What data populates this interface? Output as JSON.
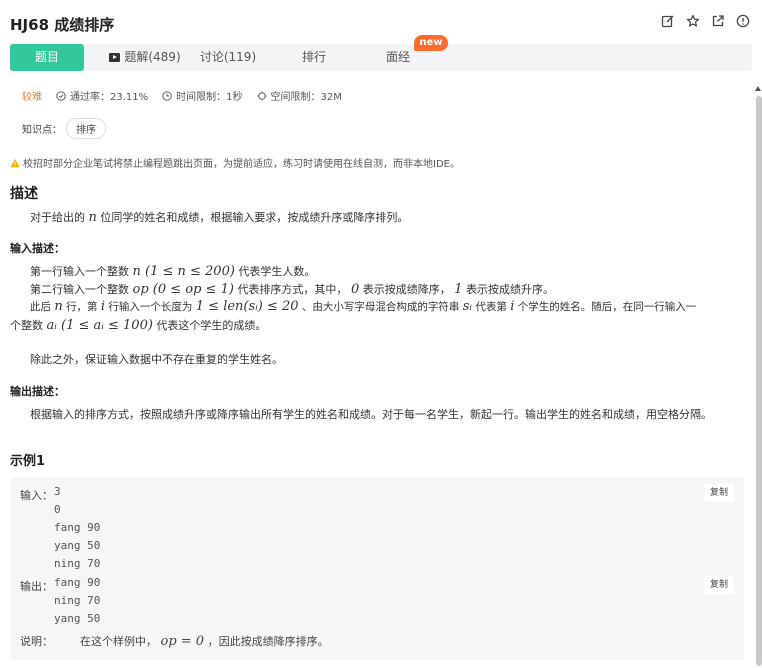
{
  "header": {
    "title": "HJ68  成绩排序",
    "icons": [
      "edit-icon",
      "star-icon",
      "external-link-icon",
      "info-icon"
    ]
  },
  "tabs": {
    "problem": "题目",
    "solutions": "题解(489)",
    "discuss": "讨论(119)",
    "rank": "排行",
    "interview": "面经",
    "new_badge": "new"
  },
  "meta": {
    "difficulty": "较难",
    "pass_rate": "通过率：23.11%",
    "time_limit": "时间限制：1秒",
    "space_limit": "空间限制：32M"
  },
  "knowledge": {
    "label": "知识点：",
    "tag": "排序"
  },
  "notice": "校招时部分企业笔试将禁止编程题跳出页面，为提前适应，练习时请使用在线自测，而非本地IDE。",
  "description": {
    "heading": "描述",
    "p1_a": "对于给出的",
    "p1_n": "n",
    "p1_b": "位同学的姓名和成绩，根据输入要求，按成绩升序或降序排列。"
  },
  "input_desc": {
    "heading": "输入描述：",
    "l1_a": "第一行输入一个整数",
    "l1_m": "n (1 ≤ n ≤ 200)",
    "l1_b": "代表学生人数。",
    "l2_a": "第二行输入一个整数",
    "l2_m": "op (0 ≤ op ≤ 1)",
    "l2_b": "代表排序方式，其中，",
    "l2_m2": "0",
    "l2_c": "表示按成绩降序，",
    "l2_m3": "1",
    "l2_d": "表示按成绩升序。",
    "l3_a": "此后",
    "l3_m": "n",
    "l3_b": "行，第",
    "l3_m2": "i",
    "l3_c": "行输入一个长度为",
    "l3_m3": "1 ≤ len(sᵢ) ≤ 20",
    "l3_d": "、由大小写字母混合构成的字符串",
    "l3_m4": "sᵢ",
    "l3_e": "代表第",
    "l3_m5": "i",
    "l3_f": "个学生的姓名。随后，在同一行输入一",
    "l4_a": "个整数",
    "l4_m": "aᵢ (1 ≤ aᵢ ≤ 100)",
    "l4_b": "代表这个学生的成绩。",
    "l5": "除此之外，保证输入数据中不存在重复的学生姓名。"
  },
  "output_desc": {
    "heading": "输出描述：",
    "text": "根据输入的排序方式，按照成绩升序或降序输出所有学生的姓名和成绩。对于每一名学生，新起一行。输出学生的姓名和成绩，用空格分隔。"
  },
  "example": {
    "heading": "示例1",
    "input_label": "输入：",
    "input_lines": [
      "3",
      "0",
      "fang 90",
      "yang 50",
      "ning 70"
    ],
    "output_label": "输出：",
    "output_lines": [
      "fang 90",
      "ning 70",
      "yang 50"
    ],
    "copy_label": "复制",
    "explain_label": "说明：",
    "explain_a": "在这个样例中，",
    "explain_m": "op = 0",
    "explain_b": "，因此按成绩降序排序。"
  }
}
